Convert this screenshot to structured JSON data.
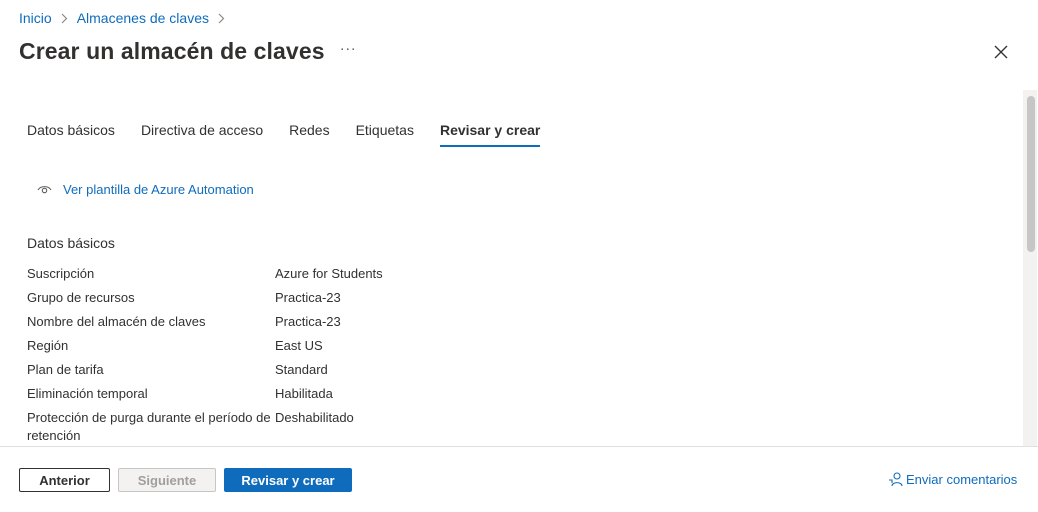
{
  "breadcrumb": {
    "items": [
      {
        "label": "Inicio"
      },
      {
        "label": "Almacenes de claves"
      }
    ]
  },
  "header": {
    "title": "Crear un almacén de claves",
    "more_label": "···"
  },
  "tabs": [
    {
      "label": "Datos básicos",
      "active": false
    },
    {
      "label": "Directiva de acceso",
      "active": false
    },
    {
      "label": "Redes",
      "active": false
    },
    {
      "label": "Etiquetas",
      "active": false
    },
    {
      "label": "Revisar y crear",
      "active": true
    }
  ],
  "template_link": {
    "label": "Ver plantilla de Azure Automation",
    "icon": "eye-icon"
  },
  "summary": {
    "section_title": "Datos básicos",
    "rows": [
      {
        "label": "Suscripción",
        "value": "Azure for Students"
      },
      {
        "label": "Grupo de recursos",
        "value": "Practica-23"
      },
      {
        "label": "Nombre del almacén de claves",
        "value": "Practica-23"
      },
      {
        "label": "Región",
        "value": "East US"
      },
      {
        "label": "Plan de tarifa",
        "value": "Standard"
      },
      {
        "label": "Eliminación temporal",
        "value": "Habilitada"
      },
      {
        "label": "Protección de purga durante el período de retención",
        "value": "Deshabilitado"
      }
    ]
  },
  "footer": {
    "prev_label": "Anterior",
    "next_label": "Siguiente",
    "create_label": "Revisar y crear",
    "feedback_label": "Enviar comentarios",
    "feedback_icon": "feedback-person-icon"
  },
  "colors": {
    "accent": "#0f6cbd",
    "text": "#323130",
    "disabled_text": "#a19f9d"
  }
}
